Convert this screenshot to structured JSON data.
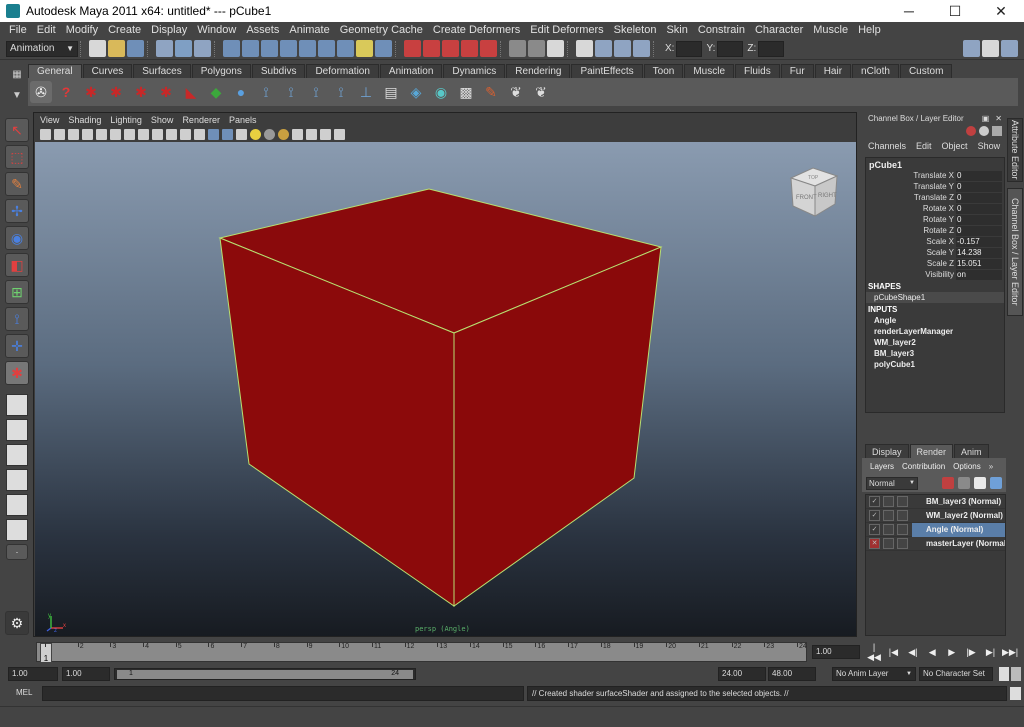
{
  "window": {
    "title": "Autodesk Maya 2011 x64: untitled*   ---   pCube1",
    "minimize": "─",
    "maximize": "☐",
    "close": "✕"
  },
  "menus": [
    "File",
    "Edit",
    "Modify",
    "Create",
    "Display",
    "Window",
    "Assets",
    "Animate",
    "Geometry Cache",
    "Create Deformers",
    "Edit Deformers",
    "Skeleton",
    "Skin",
    "Constrain",
    "Character",
    "Muscle",
    "Help"
  ],
  "status_line": {
    "mode": "Animation",
    "x_label": "X:",
    "y_label": "Y:",
    "z_label": "Z:"
  },
  "shelf": {
    "tabs": [
      "General",
      "Curves",
      "Surfaces",
      "Polygons",
      "Subdivs",
      "Deformation",
      "Animation",
      "Dynamics",
      "Rendering",
      "PaintEffects",
      "Toon",
      "Muscle",
      "Fluids",
      "Fur",
      "Hair",
      "nCloth",
      "Custom"
    ],
    "active_tab": "General"
  },
  "viewport": {
    "menus": [
      "View",
      "Shading",
      "Lighting",
      "Show",
      "Renderer",
      "Panels"
    ],
    "camera_label": "persp (Angle)",
    "viewcube_front": "FRONT",
    "viewcube_right": "RIGHT",
    "viewcube_top": "TOP",
    "axis_x": "x",
    "axis_y": "y",
    "axis_z": "z",
    "colors": {
      "cube_top": "#8a0a0c",
      "cube_front": "#8c0a0b",
      "cube_right": "#8a090a",
      "edges": "#b8e070"
    }
  },
  "channel_box": {
    "title": "Channel Box / Layer Editor",
    "menus": [
      "Channels",
      "Edit",
      "Object",
      "Show"
    ],
    "object": "pCube1",
    "attributes": [
      {
        "name": "Translate X",
        "value": "0"
      },
      {
        "name": "Translate Y",
        "value": "0"
      },
      {
        "name": "Translate Z",
        "value": "0"
      },
      {
        "name": "Rotate X",
        "value": "0"
      },
      {
        "name": "Rotate Y",
        "value": "0"
      },
      {
        "name": "Rotate Z",
        "value": "0"
      },
      {
        "name": "Scale X",
        "value": "-0.157"
      },
      {
        "name": "Scale Y",
        "value": "14.238"
      },
      {
        "name": "Scale Z",
        "value": "15.051"
      },
      {
        "name": "Visibility",
        "value": "on"
      }
    ],
    "shapes_label": "SHAPES",
    "shape": "pCubeShape1",
    "inputs_label": "INPUTS",
    "inputs": [
      "Angle",
      "renderLayerManager",
      "WM_layer2",
      "BM_layer3",
      "polyCube1"
    ]
  },
  "side_tabs": {
    "attribute_editor": "Attribute Editor",
    "channel_box": "Channel Box / Layer Editor"
  },
  "layer_editor": {
    "tabs": [
      "Display",
      "Render",
      "Anim"
    ],
    "active_tab": "Render",
    "menus": [
      "Layers",
      "Contribution",
      "Options"
    ],
    "blend_mode": "Normal",
    "layers": [
      {
        "name": "BM_layer3 (Normal)",
        "selected": false
      },
      {
        "name": "WM_layer2 (Normal)",
        "selected": false
      },
      {
        "name": "Angle (Normal)",
        "selected": true
      },
      {
        "name": "masterLayer (Normal)",
        "selected": false
      }
    ]
  },
  "time_slider": {
    "ticks": [
      "1",
      "2",
      "3",
      "4",
      "5",
      "6",
      "7",
      "8",
      "9",
      "10",
      "11",
      "12",
      "13",
      "14",
      "15",
      "16",
      "17",
      "18",
      "19",
      "20",
      "21",
      "22",
      "23",
      "24"
    ],
    "current_frame": "1",
    "current_time": "1.00"
  },
  "range_slider": {
    "start_time": "1.00",
    "playback_start": "1.00",
    "range_start": "1",
    "range_end": "24",
    "playback_end": "24.00",
    "end_time": "48.00",
    "anim_layer": "No Anim Layer",
    "character_set": "No Character Set"
  },
  "command_line": {
    "label": "MEL",
    "result": "// Created shader surfaceShader and assigned to the selected objects. //"
  }
}
